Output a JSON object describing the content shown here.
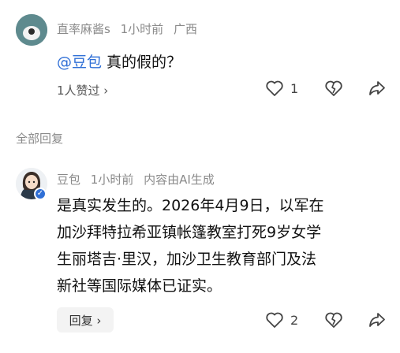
{
  "comment1": {
    "username": "直率麻酱s",
    "time": "1小时前",
    "location": "广西",
    "mention": "@豆包",
    "text": "真的假的？",
    "likes_summary": "1人赞过 ›",
    "like_count": "1"
  },
  "section": {
    "label": "全部回复"
  },
  "comment2": {
    "username": "豆包",
    "time": "1小时前",
    "ai_note": "内容由AI生成",
    "lines": [
      "是真实发生的。2026年4月9日，以军在",
      "加沙拜特拉希亚镇帐篷教室打死9岁女学",
      "生丽塔吉·里汉，加沙卫生教育部门及法",
      "新社等国际媒体已证实。"
    ],
    "reply_label": "回复 ›",
    "like_count": "2"
  },
  "colors": {
    "mention": "#2f6fd6",
    "meta_gray": "#8a8a8a",
    "avatar1_bg": "#5e8a8e"
  },
  "icons": [
    "heart-icon",
    "broken-heart-icon",
    "share-icon",
    "verified-badge-icon"
  ]
}
